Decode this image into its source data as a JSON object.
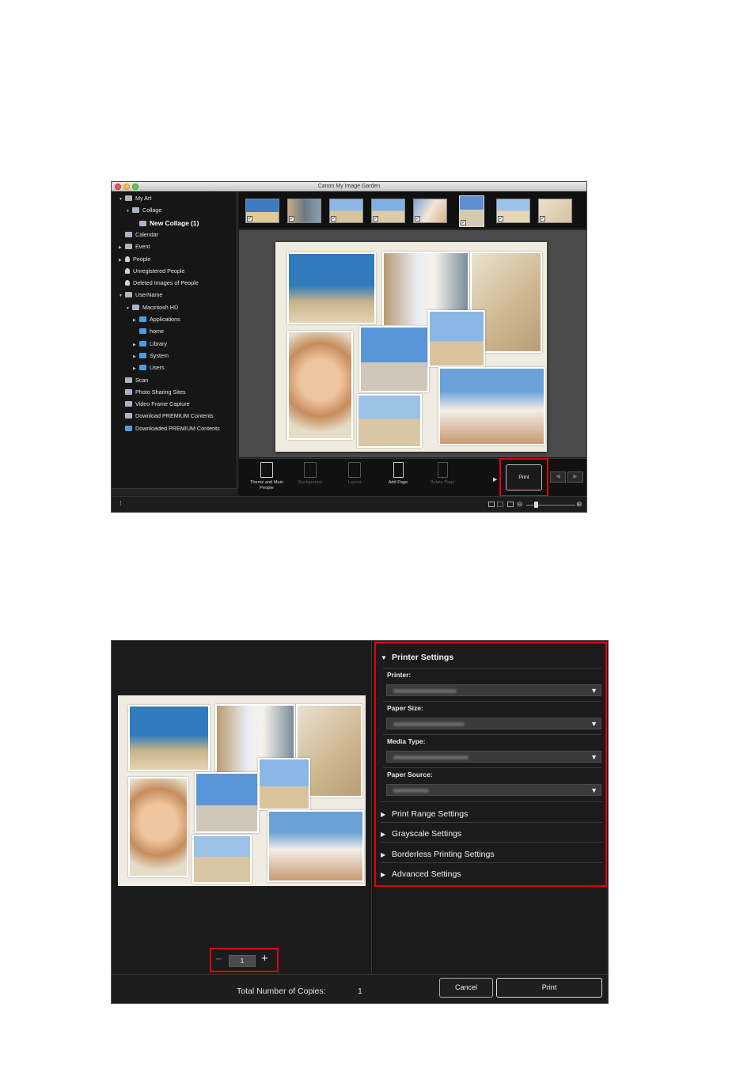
{
  "window1": {
    "title": "Canon My Image Garden",
    "sidebar": [
      {
        "label": "My Art",
        "indent": 0,
        "tri": "▼",
        "icon": "art-icon"
      },
      {
        "label": "Collage",
        "indent": 1,
        "tri": "▼",
        "icon": "collage-icon"
      },
      {
        "label": "New Collage (1)",
        "indent": 2,
        "tri": "",
        "icon": "collage-item-icon",
        "bold": true
      },
      {
        "label": "Calendar",
        "indent": 0,
        "tri": "",
        "icon": "calendar-icon"
      },
      {
        "label": "Event",
        "indent": 0,
        "tri": "▶",
        "icon": "event-icon"
      },
      {
        "label": "People",
        "indent": 0,
        "tri": "▶",
        "icon": "people-icon"
      },
      {
        "label": "Unregistered People",
        "indent": 0,
        "tri": "",
        "icon": "unregistered-people-icon"
      },
      {
        "label": "Deleted Images of People",
        "indent": 0,
        "tri": "",
        "icon": "deleted-people-icon"
      },
      {
        "label": "UserName",
        "indent": 0,
        "tri": "▼",
        "icon": "computer-icon"
      },
      {
        "label": "Macintosh HD",
        "indent": 1,
        "tri": "▼",
        "icon": "disk-icon"
      },
      {
        "label": "Applications",
        "indent": 2,
        "tri": "▶",
        "icon": "folder-icon"
      },
      {
        "label": "home",
        "indent": 2,
        "tri": "",
        "icon": "home-folder-icon"
      },
      {
        "label": "Library",
        "indent": 2,
        "tri": "▶",
        "icon": "folder-icon"
      },
      {
        "label": "System",
        "indent": 2,
        "tri": "▶",
        "icon": "folder-icon"
      },
      {
        "label": "Users",
        "indent": 2,
        "tri": "▶",
        "icon": "folder-icon"
      },
      {
        "label": "Scan",
        "indent": 0,
        "tri": "",
        "icon": "scan-icon"
      },
      {
        "label": "Photo Sharing Sites",
        "indent": 0,
        "tri": "",
        "icon": "photo-sharing-icon"
      },
      {
        "label": "Video Frame Capture",
        "indent": 0,
        "tri": "",
        "icon": "video-icon"
      },
      {
        "label": "Download PREMIUM Contents",
        "indent": 0,
        "tri": "",
        "icon": "download-icon"
      },
      {
        "label": "Downloaded PREMIUM Contents",
        "indent": 0,
        "tri": "",
        "icon": "downloaded-folder-icon"
      }
    ],
    "toolbar": {
      "theme_label": "Theme and Main People",
      "background_label": "Background",
      "layout_label": "Layout",
      "add_page_label": "Add Page",
      "delete_page_label": "Delete Page",
      "print_label": "Print"
    }
  },
  "window2": {
    "printer_settings": {
      "title": "Printer Settings",
      "printer_label": "Printer:",
      "paper_size_label": "Paper Size:",
      "media_type_label": "Media Type:",
      "paper_source_label": "Paper Source:"
    },
    "collapsed_sections": [
      "Print Range Settings",
      "Grayscale Settings",
      "Borderless Printing Settings",
      "Advanced Settings"
    ],
    "copies_value": "1",
    "total_copies_label": "Total Number of Copies:",
    "total_copies_value": "1",
    "cancel_label": "Cancel",
    "print_label": "Print"
  },
  "colors": {
    "highlight": "#e3000f",
    "panel": "#1b1b1b",
    "text": "#e4e4e4"
  }
}
